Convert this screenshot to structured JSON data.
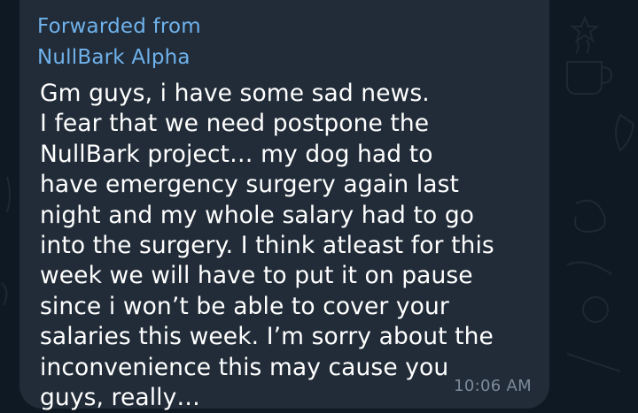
{
  "message": {
    "forwarded_label": "Forwarded from",
    "forwarded_from": "NullBark Alpha",
    "text": "Gm guys, i have some sad news.\nI fear that we need postpone the\nNullBark project… my dog had to\nhave emergency surgery again last\nnight and my whole salary had to go\ninto the surgery. I think atleast for this\nweek we will have to put it on pause\nsince i won’t be able to cover your\nsalaries this week. I’m sorry about the\ninconvenience this may cause you\nguys, really…",
    "time": "10:06 AM"
  },
  "colors": {
    "background": "#0f1923",
    "bubble": "#212c38",
    "forward_accent": "#6fb2ec",
    "message_text": "#ffffff",
    "timestamp": "#7c8a99"
  },
  "icons": [
    "coffee-cup-icon",
    "strawberry-icon",
    "star-doodle-icon",
    "swirl-doodle-icon"
  ]
}
